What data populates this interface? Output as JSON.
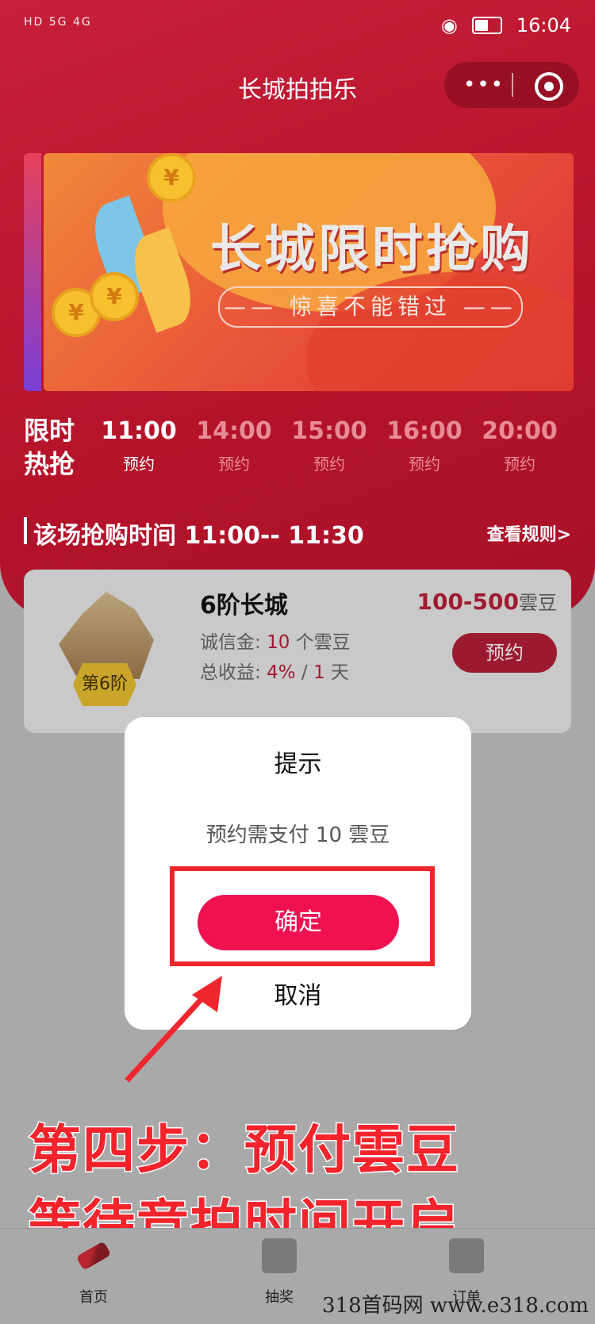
{
  "status_bar": {
    "network": "HD 5G 4G",
    "time": "16:04"
  },
  "header": {
    "title": "长城拍拍乐",
    "menu_dots": "•••"
  },
  "banner": {
    "title": "长城限时抢购",
    "subtitle": "—— 惊喜不能错过 ——"
  },
  "flash_sale": {
    "label": "限时热抢",
    "slots": [
      {
        "time": "11:00",
        "status": "预约"
      },
      {
        "time": "14:00",
        "status": "预约"
      },
      {
        "time": "15:00",
        "status": "预约"
      },
      {
        "time": "16:00",
        "status": "预约"
      },
      {
        "time": "20:00",
        "status": "预约"
      }
    ],
    "session_time": "该场抢购时间 11:00-- 11:30",
    "rules_link": "查看规则>"
  },
  "product": {
    "name": "6阶长城",
    "badge": "第6阶",
    "price_range": "100-500",
    "price_unit": "雲豆",
    "deposit_label": "诚信金: ",
    "deposit_value": "10",
    "deposit_unit": " 个雲豆",
    "yield_label": "总收益: ",
    "yield_rate": "4%",
    "yield_sep": " / ",
    "yield_days": "1",
    "yield_unit": " 天",
    "reserve_button": "预约"
  },
  "dialog": {
    "title": "提示",
    "message": "预约需支付 10 雲豆",
    "confirm": "确定",
    "cancel": "取消"
  },
  "annotation": {
    "line1": "第四步：预付雲豆",
    "line2": "等待竞拍时间开启"
  },
  "tabbar": {
    "items": [
      {
        "label": "首页",
        "icon": "auction-hammer-icon"
      },
      {
        "label": "抽奖",
        "icon": "gift-icon"
      },
      {
        "label": "订单",
        "icon": "document-icon"
      }
    ]
  },
  "watermark": "318首码网 www.e318.com",
  "colors": {
    "primary_red": "#c81f3a",
    "confirm_pink": "#ef1150",
    "annotation_red": "#f3232c"
  }
}
